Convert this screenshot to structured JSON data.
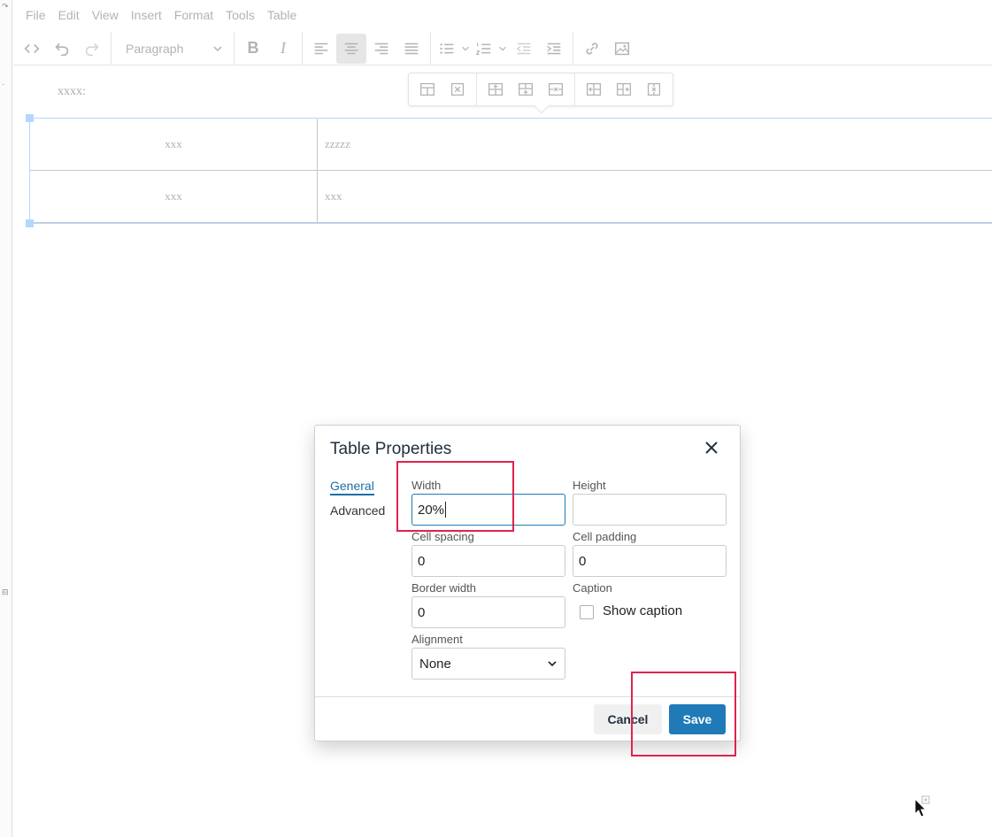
{
  "menubar": {
    "items": [
      "File",
      "Edit",
      "View",
      "Insert",
      "Format",
      "Tools",
      "Table"
    ]
  },
  "toolbar": {
    "block_format": "Paragraph",
    "icons": [
      "source-code-icon",
      "undo-icon",
      "redo-icon",
      "bold-icon",
      "italic-icon",
      "align-left-icon",
      "align-center-icon",
      "align-right-icon",
      "align-justify-icon",
      "bullet-list-icon",
      "numbered-list-icon",
      "outdent-icon",
      "indent-icon",
      "link-icon",
      "image-icon"
    ],
    "bold_label": "B",
    "italic_label": "I"
  },
  "content": {
    "label": "xxxx:",
    "table": [
      [
        "xxx",
        "zzzzz"
      ],
      [
        "xxx",
        "xxx"
      ]
    ]
  },
  "table_toolbar": {
    "icons": [
      "table-props-icon",
      "table-delete-icon",
      "row-insert-before-icon",
      "row-insert-after-icon",
      "row-delete-icon",
      "col-insert-before-icon",
      "col-insert-after-icon",
      "col-delete-icon"
    ]
  },
  "dialog": {
    "title": "Table Properties",
    "tabs": [
      "General",
      "Advanced"
    ],
    "fields": {
      "width_label": "Width",
      "width_value": "20%",
      "height_label": "Height",
      "height_value": "",
      "cell_spacing_label": "Cell spacing",
      "cell_spacing_value": "0",
      "cell_padding_label": "Cell padding",
      "cell_padding_value": "0",
      "border_width_label": "Border width",
      "border_width_value": "0",
      "caption_label": "Caption",
      "show_caption_label": "Show caption",
      "show_caption_checked": false,
      "alignment_label": "Alignment",
      "alignment_value": "None"
    },
    "cancel_label": "Cancel",
    "save_label": "Save"
  },
  "colors": {
    "accent": "#207ab7",
    "annotation": "#e0234d",
    "selection": "#b4d7ff"
  }
}
